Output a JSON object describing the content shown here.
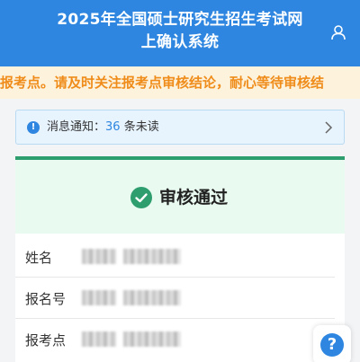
{
  "header": {
    "title": "2025年全国硕士研究生招生考试网上确认系统"
  },
  "marquee": {
    "text": "报考点。请及时关注报考点审核结论，耐心等待审核结"
  },
  "notice": {
    "label": "消息通知：",
    "count": "36",
    "suffix": " 条未读"
  },
  "status": {
    "text": "审核通过"
  },
  "info_rows": [
    {
      "label": "姓名"
    },
    {
      "label": "报名号"
    },
    {
      "label": "报考点"
    }
  ],
  "colors": {
    "primary": "#2e86e0",
    "success": "#2f9e6f",
    "warning_text": "#ef8c1a"
  },
  "icons": {
    "user": "user-icon",
    "notice": "info-icon",
    "arrow": "chevron-right-icon",
    "status": "check-circle-icon",
    "help": "question-icon"
  }
}
